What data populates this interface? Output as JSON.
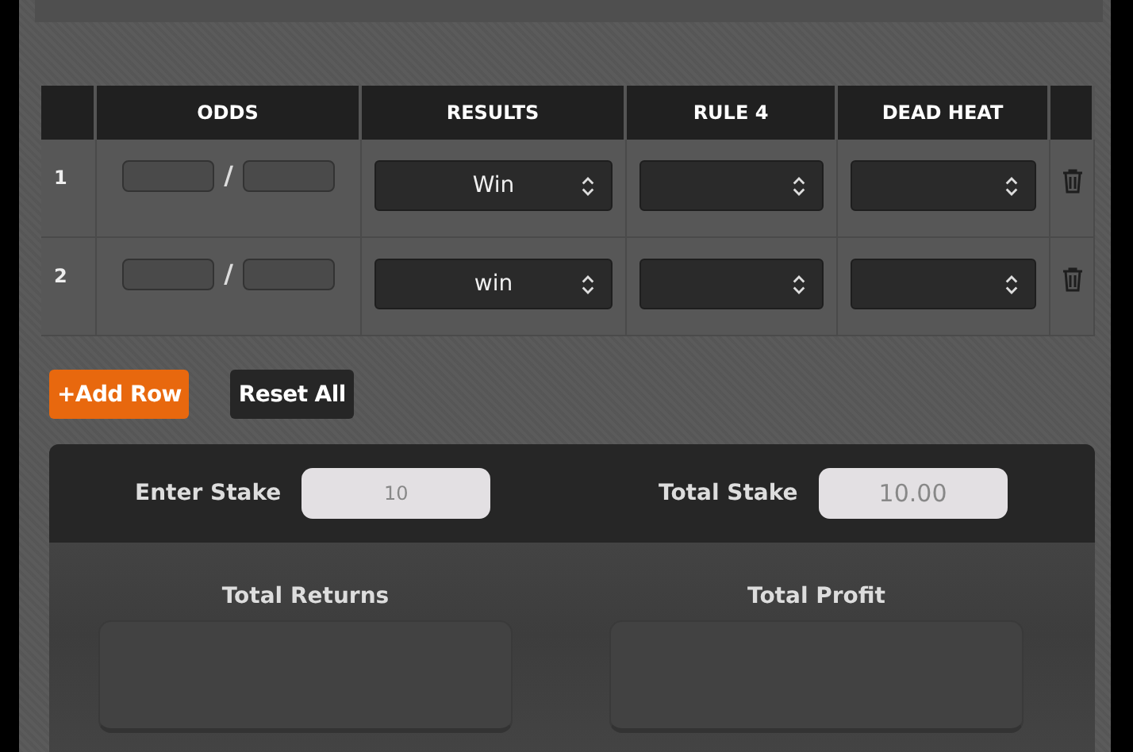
{
  "table": {
    "columns": [
      "ODDS",
      "RESULTS",
      "RULE 4",
      "DEAD HEAT"
    ],
    "odds_separator": "/",
    "rows": [
      {
        "number": "1",
        "result": "Win"
      },
      {
        "number": "2",
        "result": "win"
      }
    ]
  },
  "buttons": [
    {
      "label": "+Add Row",
      "kind": "primary"
    },
    {
      "label": "Reset All",
      "kind": "secondary"
    }
  ],
  "stake": {
    "enter_label": "Enter Stake",
    "enter_value": "10",
    "total_label": "Total Stake",
    "total_value": "10.00"
  },
  "totals": [
    {
      "label": "Total Returns"
    },
    {
      "label": "Total Profit"
    }
  ]
}
